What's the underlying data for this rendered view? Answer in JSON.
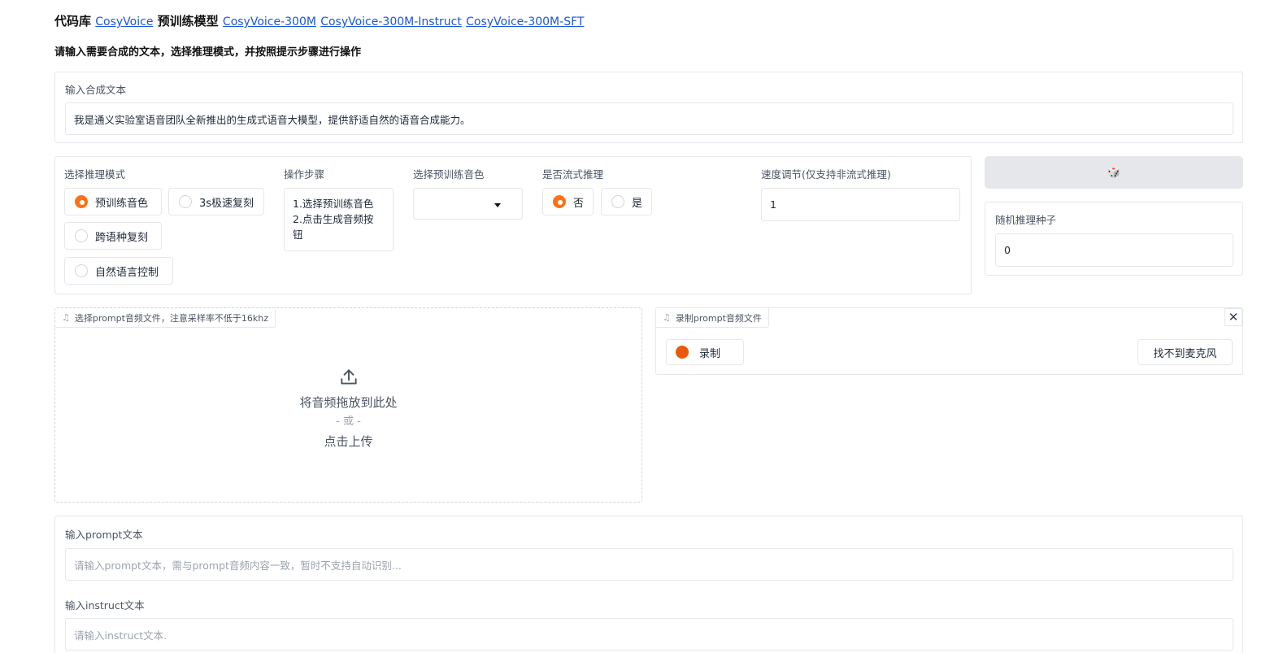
{
  "header": {
    "code_label": "代码库",
    "code_link": "CosyVoice",
    "models_label": "预训练模型",
    "model_links": [
      "CosyVoice-300M",
      "CosyVoice-300M-Instruct",
      "CosyVoice-300M-SFT"
    ],
    "instructions": "请输入需要合成的文本，选择推理模式，并按照提示步骤进行操作"
  },
  "tts_text": {
    "label": "输入合成文本",
    "value": "我是通义实验室语音团队全新推出的生成式语音大模型，提供舒适自然的语音合成能力。"
  },
  "mode": {
    "label": "选择推理模式",
    "options": [
      "预训练音色",
      "3s极速复刻",
      "跨语种复刻",
      "自然语言控制"
    ],
    "selected": "预训练音色"
  },
  "steps": {
    "label": "操作步骤",
    "lines": [
      "1.选择预训练音色",
      "2.点击生成音频按",
      "钮"
    ]
  },
  "speaker": {
    "label": "选择预训练音色",
    "value": ""
  },
  "stream": {
    "label": "是否流式推理",
    "options": [
      "否",
      "是"
    ],
    "selected": "否"
  },
  "speed": {
    "label": "速度调节(仅支持非流式推理)",
    "value": "1"
  },
  "seed_button": {
    "icon": "dice-icon",
    "glyph": "🎲"
  },
  "seed": {
    "label": "随机推理种子",
    "value": "0"
  },
  "prompt_upload": {
    "label": "选择prompt音频文件，注意采样率不低于16khz",
    "drop_text": "将音频拖放到此处",
    "or_text": "- 或 -",
    "click_text": "点击上传"
  },
  "prompt_record": {
    "label": "录制prompt音频文件",
    "record_label": "录制",
    "mic_label": "找不到麦克风",
    "close_glyph": "✕"
  },
  "prompt_text": {
    "label": "输入prompt文本",
    "placeholder": "请输入prompt文本，需与prompt音频内容一致，暂时不支持自动识别..."
  },
  "instruct_text": {
    "label": "输入instruct文本",
    "placeholder": "请输入instruct文本."
  },
  "colors": {
    "accent": "#f97316",
    "link": "#1a56db",
    "record": "#ea580c"
  }
}
